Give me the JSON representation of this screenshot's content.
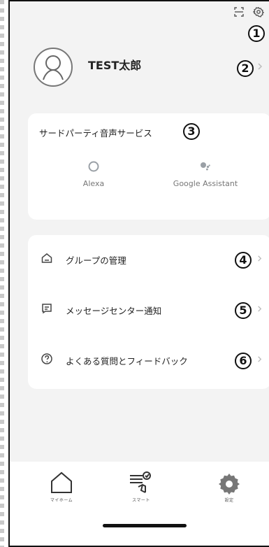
{
  "colors": {
    "frame_bg": "#f3f3f3",
    "card_bg": "#ffffff",
    "text_primary": "#222222",
    "text_secondary": "#777777"
  },
  "top_bar": {
    "icons": [
      "scan-icon",
      "settings-icon"
    ]
  },
  "badges": {
    "b1": "1",
    "b2": "2",
    "b3": "3",
    "b4": "4",
    "b5": "5",
    "b6": "6"
  },
  "profile": {
    "name": "TEST太郎"
  },
  "third_party": {
    "title": "サードパーティ音声サービス",
    "services": [
      {
        "name": "Alexa",
        "icon": "alexa-icon"
      },
      {
        "name": "Google Assistant",
        "icon": "google-assistant-icon"
      }
    ]
  },
  "menu": {
    "items": [
      {
        "label": "グループの管理",
        "icon": "home-outline-icon"
      },
      {
        "label": "メッセージセンター通知",
        "icon": "message-icon"
      },
      {
        "label": "よくある質問とフィードバック",
        "icon": "help-icon"
      }
    ]
  },
  "tabbar": {
    "tabs": [
      {
        "label": "マイホーム",
        "icon": "home-tab-icon"
      },
      {
        "label": "スマート",
        "icon": "smart-tab-icon"
      },
      {
        "label": "設定",
        "icon": "settings-tab-icon"
      }
    ]
  }
}
